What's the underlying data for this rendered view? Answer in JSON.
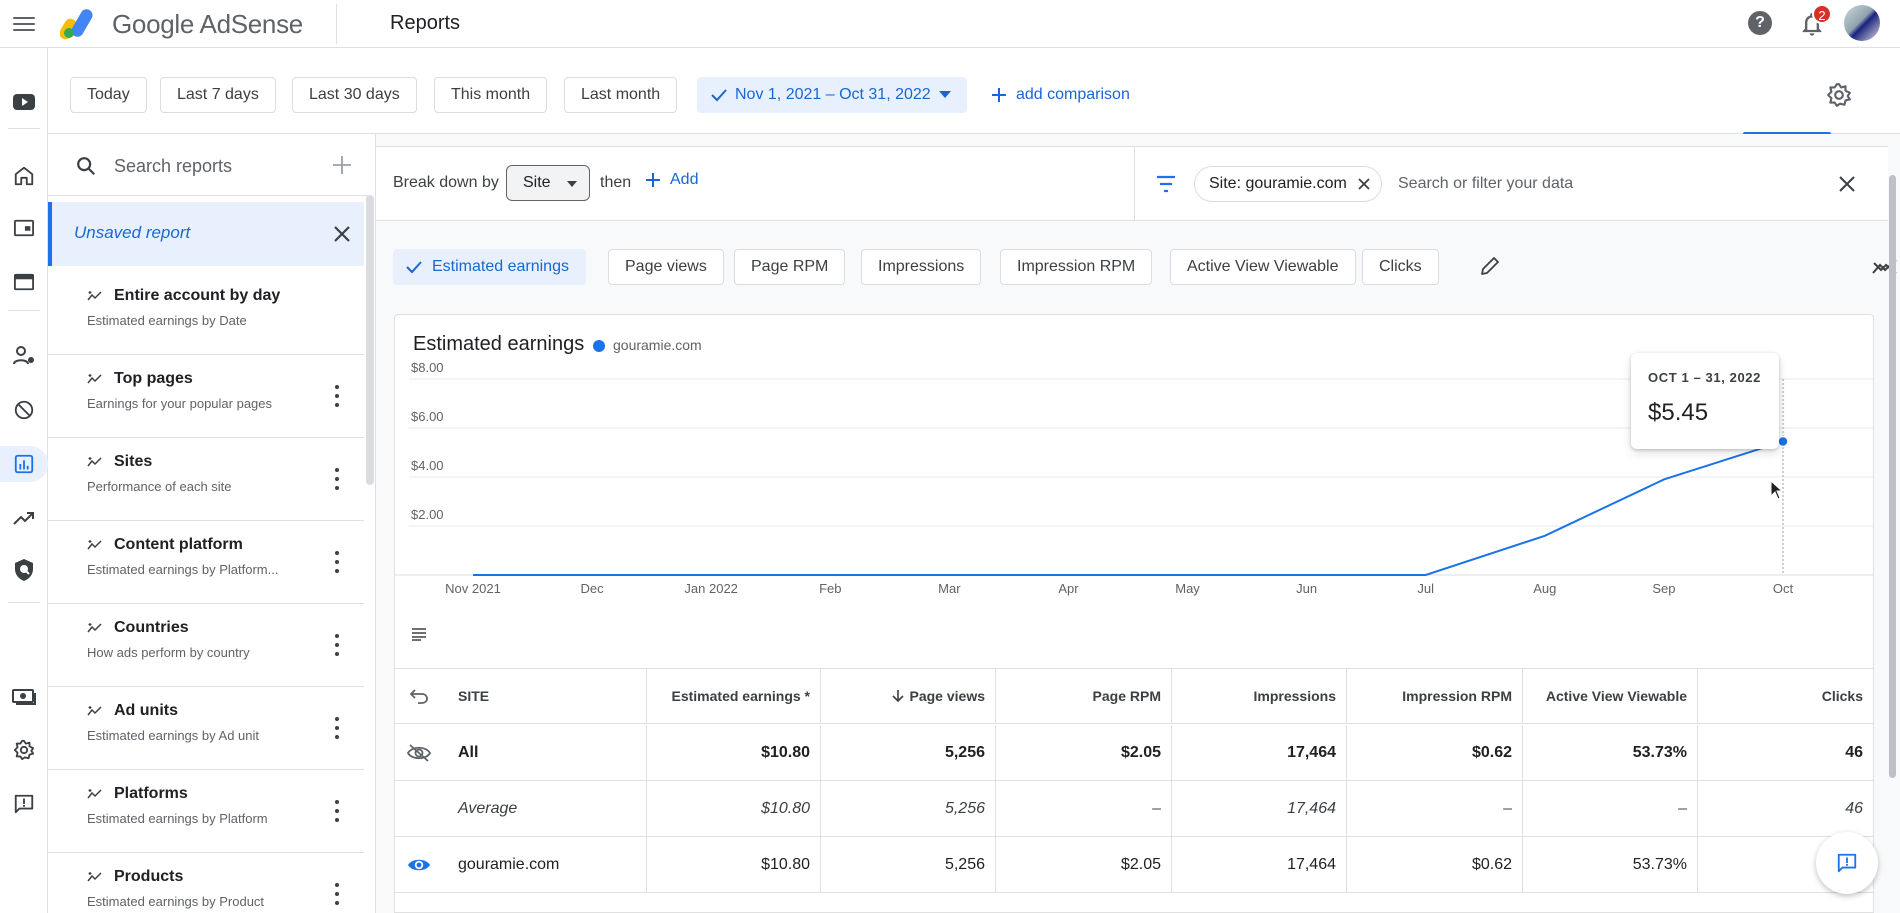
{
  "app": {
    "product_name": "Google AdSense",
    "page_title": "Reports",
    "notification_count": "2"
  },
  "date_ranges": {
    "today": "Today",
    "last_7_days": "Last 7 days",
    "last_30_days": "Last 30 days",
    "this_month": "This month",
    "last_month": "Last month",
    "selected": "Nov 1, 2021 – Oct 31, 2022",
    "add_comparison": "add comparison"
  },
  "reports_panel": {
    "search_placeholder": "Search reports",
    "unsaved_label": "Unsaved report",
    "items": [
      {
        "title": "Entire account by day",
        "subtitle": "Estimated earnings by Date"
      },
      {
        "title": "Top pages",
        "subtitle": "Earnings for your popular pages"
      },
      {
        "title": "Sites",
        "subtitle": "Performance of each site"
      },
      {
        "title": "Content platform",
        "subtitle": "Estimated earnings by Platform..."
      },
      {
        "title": "Countries",
        "subtitle": "How ads perform by country"
      },
      {
        "title": "Ad units",
        "subtitle": "Estimated earnings by Ad unit"
      },
      {
        "title": "Platforms",
        "subtitle": "Estimated earnings by Platform"
      },
      {
        "title": "Products",
        "subtitle": "Estimated earnings by Product"
      }
    ]
  },
  "breakdown": {
    "label": "Break down by",
    "selected": "Site",
    "then": "then",
    "add": "Add",
    "filter_chip": "Site: gouramie.com",
    "filter_placeholder": "Search or filter your data"
  },
  "metrics": [
    {
      "label": "Estimated earnings",
      "selected": true
    },
    {
      "label": "Page views",
      "selected": false
    },
    {
      "label": "Page RPM",
      "selected": false
    },
    {
      "label": "Impressions",
      "selected": false
    },
    {
      "label": "Impression RPM",
      "selected": false
    },
    {
      "label": "Active View Viewable",
      "selected": false
    },
    {
      "label": "Clicks",
      "selected": false
    }
  ],
  "chart": {
    "title": "Estimated earnings",
    "legend": "gouramie.com",
    "tooltip_date": "OCT 1 – 31, 2022",
    "tooltip_value": "$5.45"
  },
  "chart_data": {
    "type": "line",
    "title": "Estimated earnings",
    "categories": [
      "Nov 2021",
      "Dec",
      "Jan 2022",
      "Feb",
      "Mar",
      "Apr",
      "May",
      "Jun",
      "Jul",
      "Aug",
      "Sep",
      "Oct"
    ],
    "series": [
      {
        "name": "gouramie.com",
        "color": "#1a73e8",
        "values": [
          0,
          0,
          0,
          0,
          0,
          0,
          0,
          0,
          0,
          1.6,
          3.9,
          5.45
        ]
      }
    ],
    "y_ticks": [
      "$2.00",
      "$4.00",
      "$6.00",
      "$8.00"
    ],
    "ylim": [
      0,
      8
    ],
    "grid": true,
    "highlight": {
      "category": "Oct",
      "value": 5.45
    }
  },
  "table": {
    "headers": [
      "SITE",
      "Estimated earnings *",
      "Page views",
      "Page RPM",
      "Impressions",
      "Impression RPM",
      "Active View Viewable",
      "Clicks"
    ],
    "rows": [
      {
        "site": "All",
        "values": [
          "$10.80",
          "5,256",
          "$2.05",
          "17,464",
          "$0.62",
          "53.73%",
          "46"
        ]
      },
      {
        "site": "Average",
        "values": [
          "$10.80",
          "5,256",
          "–",
          "17,464",
          "–",
          "–",
          "46"
        ]
      },
      {
        "site": "gouramie.com",
        "values": [
          "$10.80",
          "5,256",
          "$2.05",
          "17,464",
          "$0.62",
          "53.73%",
          ""
        ]
      }
    ]
  },
  "colors": {
    "accent": "#1a73e8",
    "accent_text": "#1967d2",
    "selected_bg": "#e8f0fe",
    "badge": "#d93025"
  }
}
